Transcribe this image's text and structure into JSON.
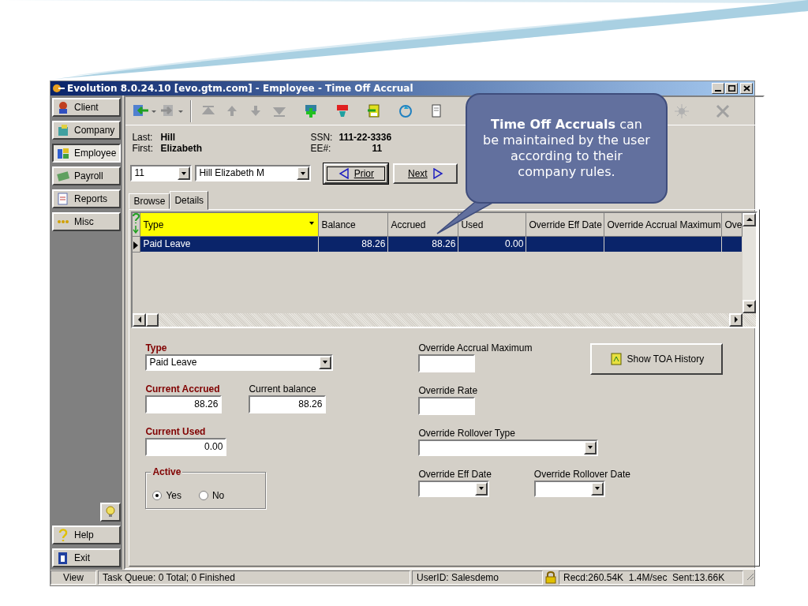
{
  "window": {
    "title": "Evolution 8.0.24.10 [evo.gtm.com] - Employee - Time Off Accrual"
  },
  "sidebar": {
    "items": [
      {
        "label": "Client",
        "selected": false
      },
      {
        "label": "Company",
        "selected": false
      },
      {
        "label": "Employee",
        "selected": true
      },
      {
        "label": "Payroll",
        "selected": false
      },
      {
        "label": "Reports",
        "selected": false
      },
      {
        "label": "Misc",
        "selected": false
      }
    ],
    "bottom_items": [
      {
        "label": "Help"
      },
      {
        "label": "Exit"
      }
    ]
  },
  "employee": {
    "last_label": "Last:",
    "last": "Hill",
    "first_label": "First:",
    "first": "Elizabeth",
    "ssn_label": "SSN:",
    "ssn": "111-22-3336",
    "ee_label": "EE#:",
    "ee": "11"
  },
  "selector": {
    "number": "11",
    "name": "Hill Elizabeth M"
  },
  "nav_buttons": [
    {
      "label": "Prior",
      "kind": "prior"
    },
    {
      "label": "Next",
      "kind": "next"
    }
  ],
  "tabs": [
    {
      "label": "Browse",
      "selected": false
    },
    {
      "label": "Details",
      "selected": true
    }
  ],
  "grid": {
    "columns": [
      "Type",
      "Balance",
      "Accrued",
      "Used",
      "Override Eff Date",
      "Override Accrual Maximum",
      "Ove"
    ],
    "rows": [
      {
        "cells": [
          "Paid Leave",
          "88.26",
          "88.26",
          "0.00"
        ],
        "selected": true
      }
    ]
  },
  "form": {
    "left": [
      {
        "kind": "select",
        "label": "Type",
        "value": "Paid Leave",
        "required": true
      },
      {
        "kind": "pair",
        "fields": [
          {
            "label": "Current Accrued",
            "value": "88.26",
            "required": true
          },
          {
            "label": "Current balance",
            "value": "88.26",
            "required": false
          }
        ]
      },
      {
        "kind": "text",
        "label": "Current Used",
        "value": "0.00",
        "required": true
      },
      {
        "kind": "radio",
        "label": "Active",
        "options": [
          {
            "label": "Yes",
            "selected": true
          },
          {
            "label": "No",
            "selected": false
          }
        ]
      }
    ],
    "right": [
      {
        "kind": "text",
        "label": "Override Accrual Maximum"
      },
      {
        "kind": "text",
        "label": "Override Rate"
      },
      {
        "kind": "select",
        "label": "Override Rollover Type"
      },
      {
        "kind": "datepair",
        "fields": [
          {
            "label": "Override Eff Date"
          },
          {
            "label": "Override Rollover Date"
          }
        ]
      }
    ],
    "history_button": "Show TOA History"
  },
  "callout": {
    "text": "**Time Off Accruals** can be maintained by the user according to their company rules."
  },
  "status_bar": [
    "View",
    "Task Queue: 0 Total; 0 Finished",
    "UserID: Salesdemo",
    "Recd:260.54K  1.4M/sec  Sent:13.66K"
  ]
}
